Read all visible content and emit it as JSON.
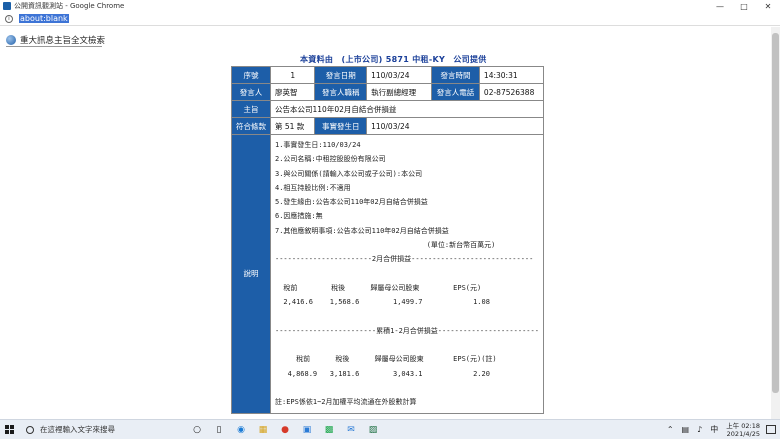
{
  "window": {
    "title": "公開資訊觀測站 - Google Chrome",
    "url": "about:blank"
  },
  "page": {
    "header": "重大訊息主旨全文檢索",
    "provider": "本資料由　(上市公司) 5871 中租-KY　公司提供"
  },
  "table": {
    "seq_label": "序號",
    "seq_value": "1",
    "date_label": "發言日期",
    "date_value": "110/03/24",
    "time_label": "發言時間",
    "time_value": "14:30:31",
    "speaker_label": "發言人",
    "speaker_value": "廖英智",
    "title_label": "發言人職稱",
    "title_value": "執行副總經理",
    "phone_label": "發言人電話",
    "phone_value": "02-87526388",
    "subject_label": "主旨",
    "subject_value": "公告本公司110年02月自結合併損益",
    "clause_label": "符合條款",
    "clause_value": "第 51 款",
    "occur_label": "事實發生日",
    "occur_value": "110/03/24",
    "desc_label": "說明",
    "desc_lines": [
      "1.事實發生日:110/03/24",
      "2.公司名稱:中租控股股份有限公司",
      "3.與公司關係(請輸入本公司或子公司):本公司",
      "4.相互持股比例:不適用",
      "5.發生緣由:公告本公司110年02月自結合併損益",
      "6.因應措施:無",
      "7.其他應敘明事項:公告本公司110年02月自結合併損益",
      "                                    (單位:新台幣百萬元)",
      "-----------------------2月合併損益-----------------------------",
      "",
      "  稅前        稅後      歸屬母公司股東        EPS(元)",
      "  2,416.6    1,568.6        1,499.7            1.08",
      "",
      "------------------------累積1-2月合併損益------------------------",
      "",
      "     稅前      稅後      歸屬母公司股東       EPS(元)(註)",
      "   4,868.9   3,181.6        3,043.1            2.20",
      "",
      "註:EPS係依1~2月加權平均流通在外股數計算"
    ]
  },
  "taskbar": {
    "search_placeholder": "在這裡輸入文字來搜尋",
    "ime": "中",
    "time": "上午 02:18",
    "date": "2021/4/25"
  }
}
